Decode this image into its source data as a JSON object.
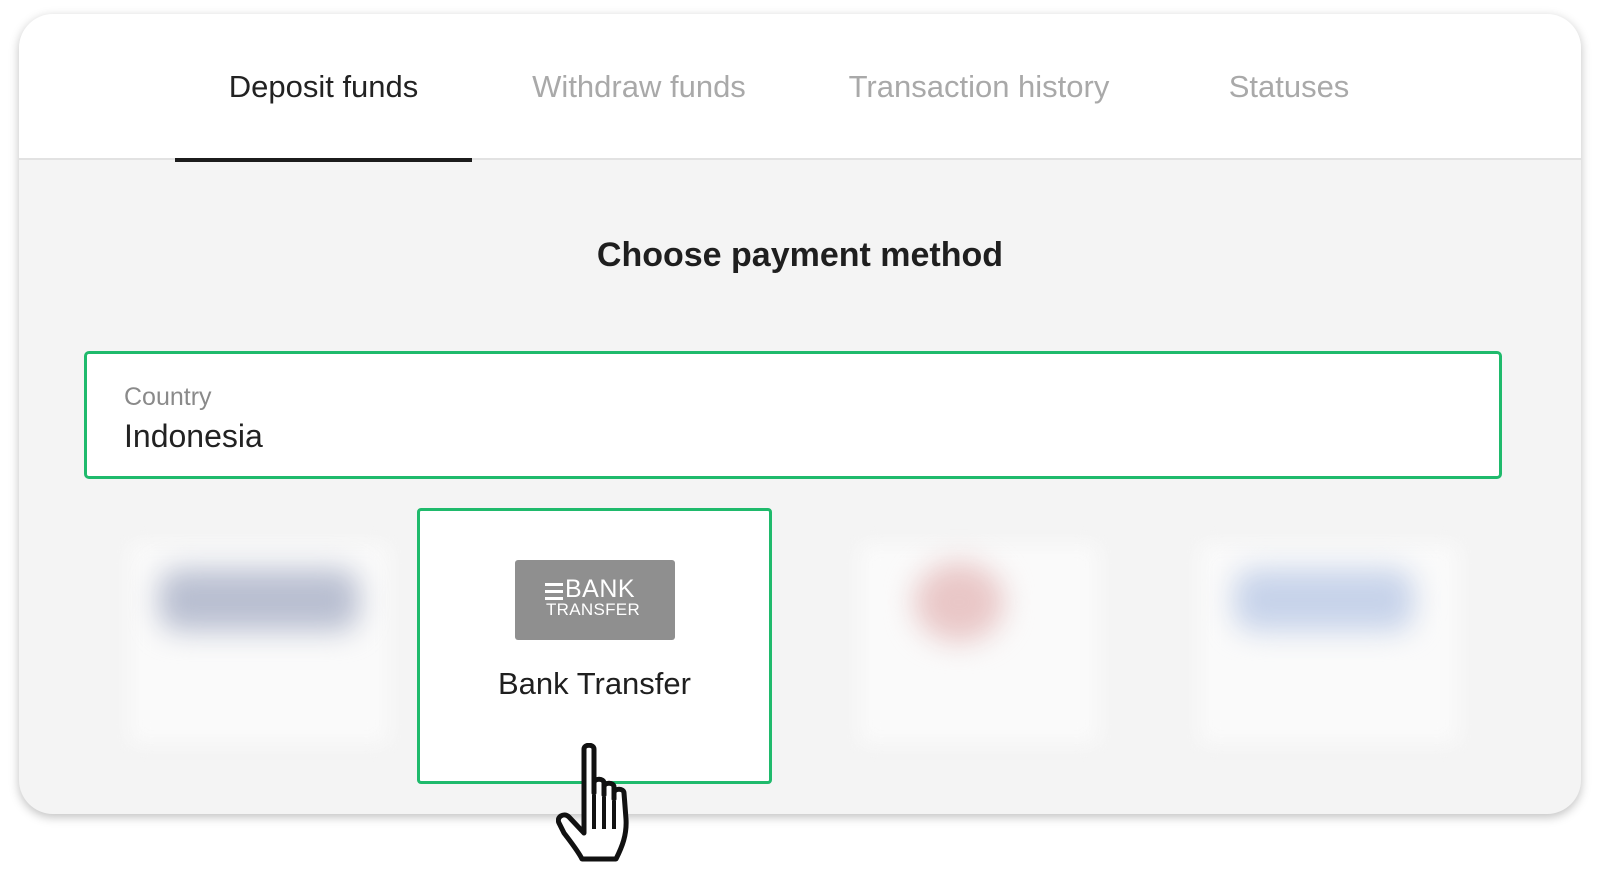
{
  "tabs": [
    {
      "label": "Deposit funds",
      "active": true
    },
    {
      "label": "Withdraw funds",
      "active": false
    },
    {
      "label": "Transaction history",
      "active": false
    },
    {
      "label": "Statuses",
      "active": false
    }
  ],
  "main": {
    "title": "Choose payment method",
    "country": {
      "label": "Country",
      "value": "Indonesia"
    },
    "methods": [
      {
        "name": "Bank Transfer",
        "logo": {
          "line1": "BANK",
          "line2": "TRANSFER",
          "icon": "menu-lines-icon"
        },
        "selected": true
      }
    ]
  },
  "colors": {
    "accent": "#1fba6c",
    "tab_active": "#222222",
    "tab_inactive": "#a9a9a9",
    "logo_bg": "#8f8f8f",
    "panel_bg": "#f4f4f4"
  },
  "overlay": {
    "cursor_icon": "hand-pointer-icon"
  }
}
